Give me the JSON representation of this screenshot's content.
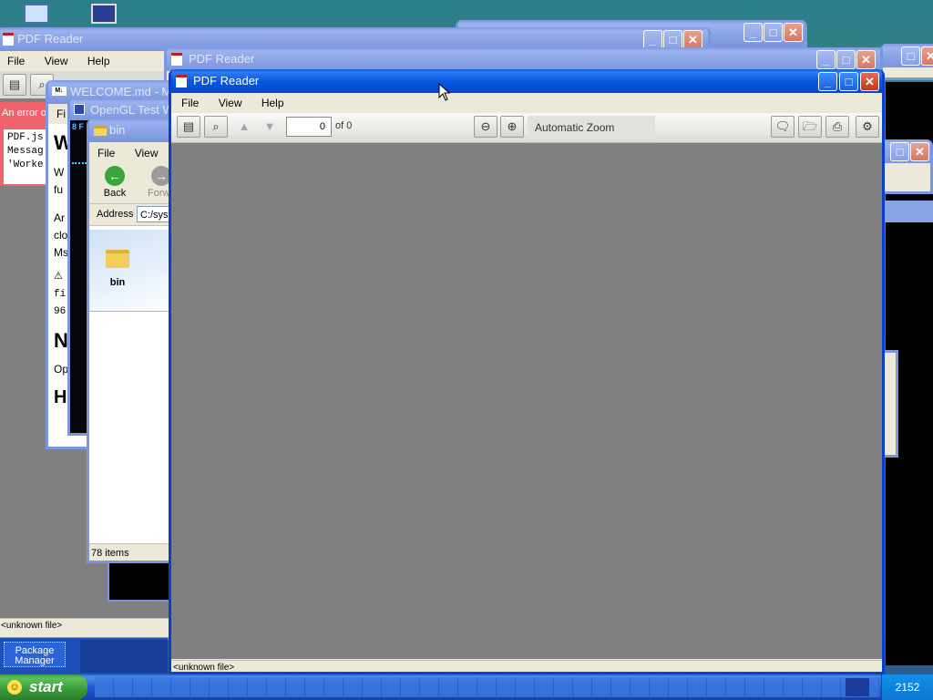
{
  "colors": {
    "desktop": "#3a6ea5",
    "title_active": "#0a58e0",
    "title_inactive": "#8aa3e6",
    "viewer_bg": "#808080"
  },
  "bg_window1": {
    "title": "PDF Reader",
    "menu": [
      "File",
      "View",
      "Help"
    ]
  },
  "bg_window2": {
    "title": "PDF Reader"
  },
  "error_panel": {
    "heading": "An error oc",
    "lines": [
      "PDF.js",
      "Messag",
      "'Worke"
    ]
  },
  "welcome_window": {
    "title": "WELCOME.md - M",
    "menu_first": "Fi",
    "heading1": "W",
    "para1": [
      "W",
      "fu"
    ],
    "para2": [
      "Ar",
      "clo",
      "Ms"
    ],
    "warn_lines": [
      "fi",
      "96"
    ],
    "heading2": "N",
    "para3": "Op",
    "heading3": "H"
  },
  "opengl_window": {
    "title": "OpenGL Test W",
    "hud": "8 F"
  },
  "explorer": {
    "title": "bin",
    "menu": [
      "File",
      "View"
    ],
    "back_label": "Back",
    "forward_label": "Forw",
    "address_label": "Address",
    "address_value": "C:/syst",
    "folder_name": "bin",
    "status": "78 items"
  },
  "bg_status": "<unknown file>",
  "package_manager": {
    "label_line1": "Package",
    "label_line2": "Manager"
  },
  "main_window": {
    "title": "PDF Reader",
    "menu": [
      "File",
      "View",
      "Help"
    ],
    "page_number": "0",
    "page_of": "of 0",
    "zoom": "Automatic Zoom",
    "status": "<unknown file>"
  },
  "taskbar": {
    "start_label": "start",
    "clock": "2152"
  },
  "icons": [
    "computer-icon",
    "sidebar-toggle-icon",
    "find-icon",
    "prev-page-icon",
    "next-page-icon",
    "zoom-out-icon",
    "zoom-in-icon",
    "comment-icon",
    "open-file-icon",
    "print-icon",
    "tools-icon",
    "back-icon",
    "forward-icon",
    "folder-icon",
    "mouse-cursor-icon"
  ]
}
